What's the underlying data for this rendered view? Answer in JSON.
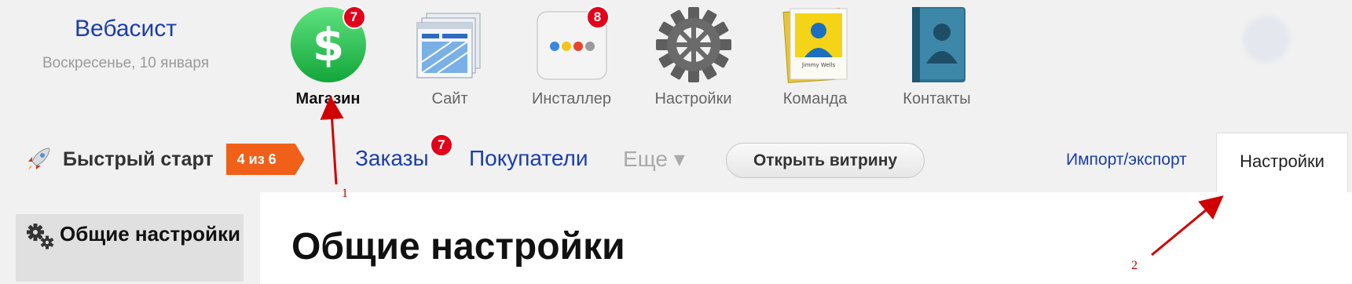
{
  "brand": {
    "name": "Вебасист",
    "date": "Воскресенье, 10 января"
  },
  "apps": [
    {
      "label": "Магазин",
      "icon": "shop-icon",
      "badge": "7",
      "active": true
    },
    {
      "label": "Сайт",
      "icon": "site-icon",
      "badge": ""
    },
    {
      "label": "Инсталлер",
      "icon": "installer-icon",
      "badge": "8"
    },
    {
      "label": "Настройки",
      "icon": "settings-gear-icon",
      "badge": ""
    },
    {
      "label": "Команда",
      "icon": "team-icon",
      "badge": "",
      "card_text": "Jimmy Wells"
    },
    {
      "label": "Контакты",
      "icon": "contacts-book-icon",
      "badge": ""
    }
  ],
  "quick_start": {
    "label": "Быстрый старт",
    "progress": "4 из 6",
    "icon": "rocket-icon"
  },
  "nav": {
    "orders": "Заказы",
    "orders_badge": "7",
    "customers": "Покупатели",
    "more": "Еще ▾"
  },
  "open_store": "Открыть витрину",
  "import_export": "Импорт/экспорт",
  "settings_tab": "Настройки",
  "sidebar": {
    "general_settings": "Общие настройки",
    "icon": "gears-icon"
  },
  "content": {
    "title": "Общие настройки"
  },
  "annotations": {
    "a1": "1",
    "a2": "2"
  },
  "colors": {
    "link": "#1a3dae",
    "badge": "#e2001a",
    "progress": "#f06018",
    "annotation": "#c00"
  }
}
